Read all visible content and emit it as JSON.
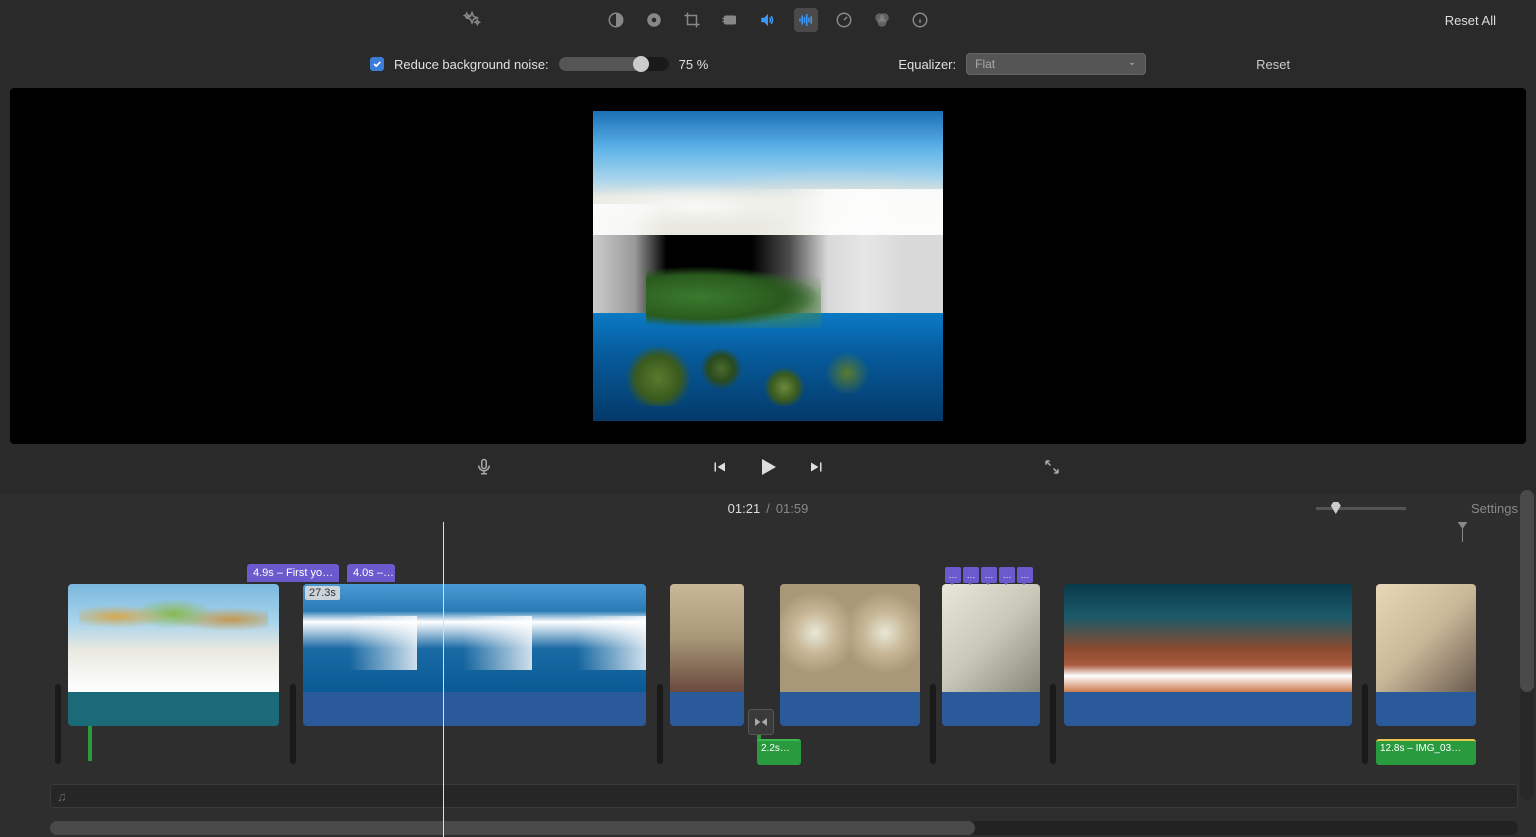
{
  "toolbar": {
    "reset_all": "Reset All"
  },
  "adjust": {
    "noise_label": "Reduce background noise:",
    "noise_value": "75 %",
    "eq_label": "Equalizer:",
    "eq_value": "Flat",
    "reset": "Reset"
  },
  "time": {
    "current": "01:21",
    "sep": " / ",
    "total": "01:59",
    "settings": "Settings"
  },
  "titles": {
    "t1": "4.9s – First yo…",
    "t2": "4.0s –…"
  },
  "clips": {
    "c2_duration": "27.3s"
  },
  "audio": {
    "a1": "2.2s…",
    "a2": "12.8s – IMG_03…"
  },
  "markers": {
    "dot": "…"
  }
}
